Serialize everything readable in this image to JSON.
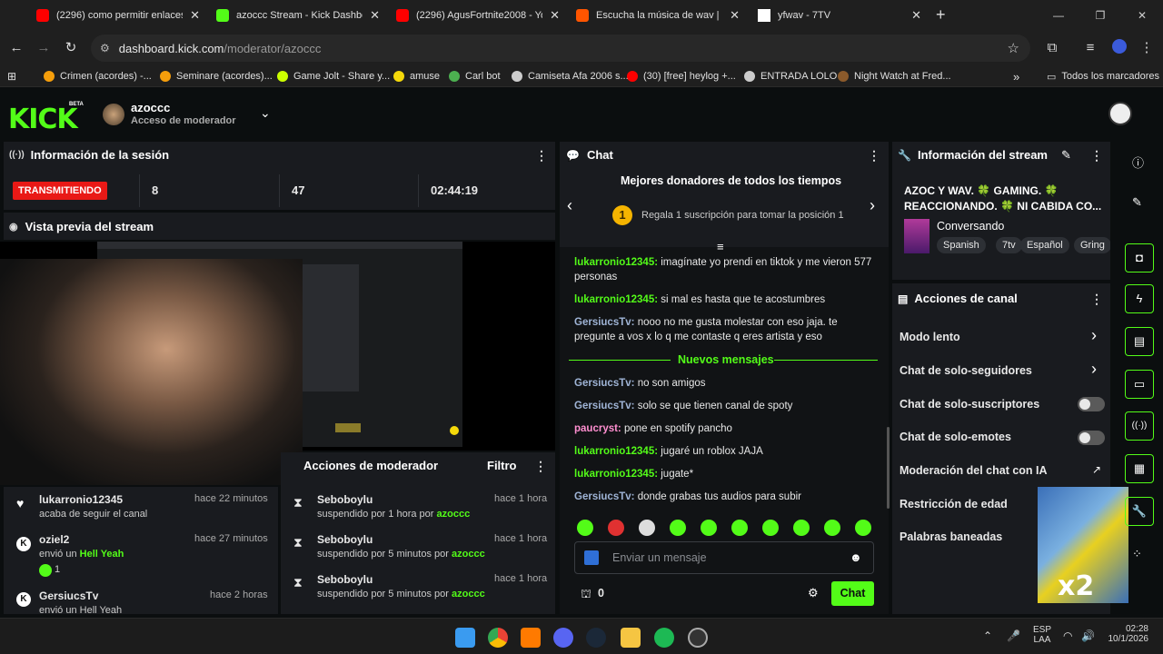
{
  "browser": {
    "tabs": [
      {
        "title": "(2296) como permitir enlaces e",
        "color": "#ff0000"
      },
      {
        "title": "azoccc Stream - Kick Dashboard",
        "color": "#53fc18"
      },
      {
        "title": "(2296) AgusFortnite2008 - YouT",
        "color": "#ff0000"
      },
      {
        "title": "Escucha la música de wav | Disf",
        "color": "#ff5500"
      },
      {
        "title": "yfwav - 7TV",
        "color": "#ffffff"
      }
    ],
    "new_tab": "+",
    "url_host": "dashboard.kick.com",
    "url_path": "/moderator/azoccc",
    "bookmarks": [
      {
        "label": "Crimen (acordes) -...",
        "color": "#f59e0b"
      },
      {
        "label": "Seminare (acordes)...",
        "color": "#f59e0b"
      },
      {
        "label": "Game Jolt - Share y...",
        "color": "#ccff00"
      },
      {
        "label": "amuse",
        "color": "#f5d90a"
      },
      {
        "label": "Carl bot",
        "color": "#4caf50"
      },
      {
        "label": "Camiseta Afa 2006 s...",
        "color": "#cccccc"
      },
      {
        "label": "(30) [free] heylog +...",
        "color": "#ff0000"
      },
      {
        "label": "ENTRADA LOLO",
        "color": "#cccccc"
      },
      {
        "label": "Night Watch at Fred...",
        "color": "#8b5a2b"
      }
    ],
    "more": "»",
    "all_bookmarks": "Todos los marcadores"
  },
  "header": {
    "logo": "KICK",
    "beta": "BETA",
    "channel": "azoccc",
    "role": "Acceso de moderador"
  },
  "session": {
    "title": "Información de la sesión",
    "status": "TRANSMITIENDO",
    "viewers": "8",
    "followers": "47",
    "uptime": "02:44:19"
  },
  "preview": {
    "title": "Vista previa del stream"
  },
  "activity": [
    {
      "user": "lukarronio12345",
      "time": "hace 22 minutos",
      "desc": "acaba de seguir el canal"
    },
    {
      "user": "oziel2",
      "time": "hace 27 minutos",
      "desc": "envió un",
      "item": "Hell Yeah",
      "count": "1"
    },
    {
      "user": "GersiucsTv",
      "time": "hace 2 horas",
      "desc": "envió un Hell Yeah"
    }
  ],
  "modactions": {
    "title": "Acciones de moderador",
    "filter": "Filtro",
    "items": [
      {
        "user": "Seboboylu",
        "time": "hace 1 hora",
        "desc": "suspendido por 1 hora por",
        "mod": "azoccc"
      },
      {
        "user": "Seboboylu",
        "time": "hace 1 hora",
        "desc": "suspendido por 5 minutos por",
        "mod": "azoccc"
      },
      {
        "user": "Seboboylu",
        "time": "hace 1 hora",
        "desc": "suspendido por 5 minutos por",
        "mod": "azoccc"
      }
    ]
  },
  "chat": {
    "title": "Chat",
    "donors_title": "Mejores donadores de todos los tiempos",
    "donor_rank": "1",
    "donor_text": "Regala 1 suscripción para tomar la posición 1",
    "messages": [
      {
        "user": "lukarronio12345:",
        "text": "imagínate yo prendi en tiktok y me vieron 577 personas"
      },
      {
        "user": "lukarronio12345:",
        "text": "si mal es hasta que te acostumbres"
      },
      {
        "user": "GersiucsTv:",
        "text": "nooo no me gusta molestar con eso jaja. te pregunte a vos x lo q me contaste q eres artista y eso"
      }
    ],
    "new_messages": "Nuevos mensajes",
    "new": [
      {
        "user": "GersiucsTv:",
        "text": "no son amigos"
      },
      {
        "user": "GersiucsTv:",
        "text": "solo se que tienen canal de spoty"
      },
      {
        "user": "paucryst:",
        "text": "pone en spotify pancho"
      },
      {
        "user": "lukarronio12345:",
        "text": "jugaré un roblox JAJA"
      },
      {
        "user": "lukarronio12345:",
        "text": "jugate*"
      },
      {
        "user": "GersiucsTv:",
        "text": "donde grabas tus audios para subir"
      }
    ],
    "placeholder": "Enviar un mensaje",
    "points": "0",
    "send": "Chat"
  },
  "streaminfo": {
    "title": "Información del stream",
    "stream_title": "AZOC Y WAV. 🍀 GAMING. 🍀 REACCIONANDO. 🍀 NI CABIDA CO...",
    "category": "Conversando",
    "tags": [
      "Spanish",
      "7tv",
      "Español",
      "Gring"
    ]
  },
  "channel_actions": {
    "title": "Acciones de canal",
    "items": [
      {
        "label": "Modo lento",
        "kind": "arrow"
      },
      {
        "label": "Chat de solo-seguidores",
        "kind": "arrow"
      },
      {
        "label": "Chat de solo-suscriptores",
        "kind": "toggle"
      },
      {
        "label": "Chat de solo-emotes",
        "kind": "toggle"
      },
      {
        "label": "Moderación del chat con IA",
        "kind": "external"
      },
      {
        "label": "Restricción de edad",
        "kind": "none"
      },
      {
        "label": "Palabras baneadas",
        "kind": "none"
      }
    ]
  },
  "overlay": {
    "multiplier": "x2"
  },
  "taskbar": {
    "lang": "ESP",
    "layout": "LAA",
    "time": "02:28",
    "date": "10/1/2026"
  }
}
